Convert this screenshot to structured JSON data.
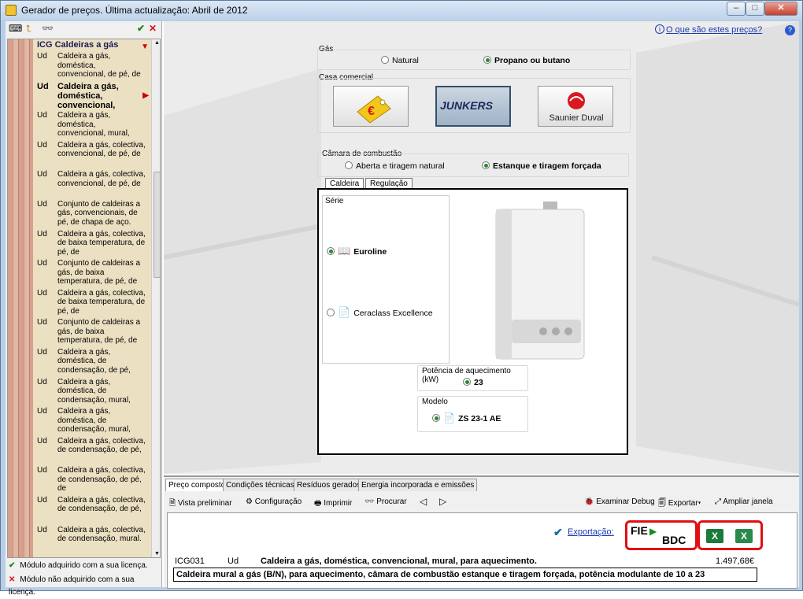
{
  "window": {
    "title": "Gerador de preços. Última actualização: Abril de 2012"
  },
  "tree": {
    "header": "ICG  Caldeiras a gás",
    "rows": [
      {
        "unit": "Ud",
        "text": "Caldeira a gás, doméstica, convencional, de pé, de"
      },
      {
        "unit": "Ud",
        "text": "Caldeira a gás, doméstica, convencional,",
        "selected": true
      },
      {
        "unit": "Ud",
        "text": "Caldeira a gás, doméstica, convencional, mural,"
      },
      {
        "unit": "Ud",
        "text": "Caldeira a gás, colectiva, convencional, de pé, de"
      },
      {
        "unit": "Ud",
        "text": "Caldeira a gás, colectiva, convencional, de pé, de"
      },
      {
        "unit": "Ud",
        "text": "Conjunto de caldeiras a gás, convencionais, de pé, de chapa de aço."
      },
      {
        "unit": "Ud",
        "text": "Caldeira a gás, colectiva, de baixa temperatura, de pé, de"
      },
      {
        "unit": "Ud",
        "text": "Conjunto de caldeiras a gás, de baixa temperatura, de pé, de"
      },
      {
        "unit": "Ud",
        "text": "Caldeira a gás, colectiva, de baixa temperatura, de pé, de"
      },
      {
        "unit": "Ud",
        "text": "Conjunto de caldeiras a gás, de baixa temperatura, de pé, de"
      },
      {
        "unit": "Ud",
        "text": "Caldeira a gás, doméstica, de condensação, de pé,"
      },
      {
        "unit": "Ud",
        "text": "Caldeira a gás, doméstica, de condensação, mural,"
      },
      {
        "unit": "Ud",
        "text": "Caldeira a gás, doméstica, de condensação, mural,"
      },
      {
        "unit": "Ud",
        "text": "Caldeira a gás, colectiva, de condensação, de pé,"
      },
      {
        "unit": "Ud",
        "text": "Caldeira a gás, colectiva, de condensação, de pé, de"
      },
      {
        "unit": "Ud",
        "text": "Caldeira a gás, colectiva, de condensação, de pé,"
      },
      {
        "unit": "Ud",
        "text": "Caldeira a gás, colectiva, de condensação, mural."
      }
    ]
  },
  "legend": {
    "acquired": "Módulo adquirido com a sua licença.",
    "not_acquired": "Módulo não adquirido com a sua licença."
  },
  "help": {
    "link": "O que são estes preços?"
  },
  "gas": {
    "label": "Gás",
    "options": [
      "Natural",
      "Propano ou butano"
    ],
    "selected": "Propano ou butano"
  },
  "casa": {
    "label": "Casa comercial",
    "brands": [
      "€",
      "JUNKERS",
      "Saunier Duval"
    ],
    "selected": "JUNKERS"
  },
  "camara": {
    "label": "Câmara de combustão",
    "options": [
      "Aberta e tiragem natural",
      "Estanque e tiragem forçada"
    ],
    "selected": "Estanque e tiragem forçada"
  },
  "inner_tabs": [
    "Caldeira",
    "Regulação"
  ],
  "serie": {
    "label": "Série",
    "options": [
      "Euroline",
      "Ceraclass Excellence"
    ],
    "selected": "Euroline"
  },
  "potencia": {
    "label": "Potência de aquecimento (kW)",
    "value": "23"
  },
  "modelo": {
    "label": "Modelo",
    "value": "ZS 23-1 AE"
  },
  "bottom_tabs": [
    "Preço composto",
    "Condições técnicas",
    "Resíduos gerados",
    "Energia incorporada e emissões"
  ],
  "toolbar": {
    "preview": "Vista preliminar",
    "config": "Configuração",
    "print": "Imprimir",
    "search": "Procurar",
    "debug": "Examinar Debug",
    "export": "Exportar",
    "expand": "Ampliar janela"
  },
  "export_label": "Exportação:",
  "fie_label_1": "FIE",
  "fie_label_2": "BDC",
  "xl_label_1": "X",
  "xl_label_2": "X",
  "price_line": {
    "code": "ICG031",
    "unit": "Ud",
    "description": "Caldeira a gás, doméstica, convencional, mural, para aquecimento.",
    "price": "1.497,68€"
  },
  "detail_text": "Caldeira mural a gás (B/N), para aquecimento, câmara de combustão estanque e tiragem forçada, potência modulante de 10 a 23",
  "colors": {
    "accent": "#1a3ab0",
    "highlight_border": "#e01010",
    "selected_brand": "#33506e"
  }
}
